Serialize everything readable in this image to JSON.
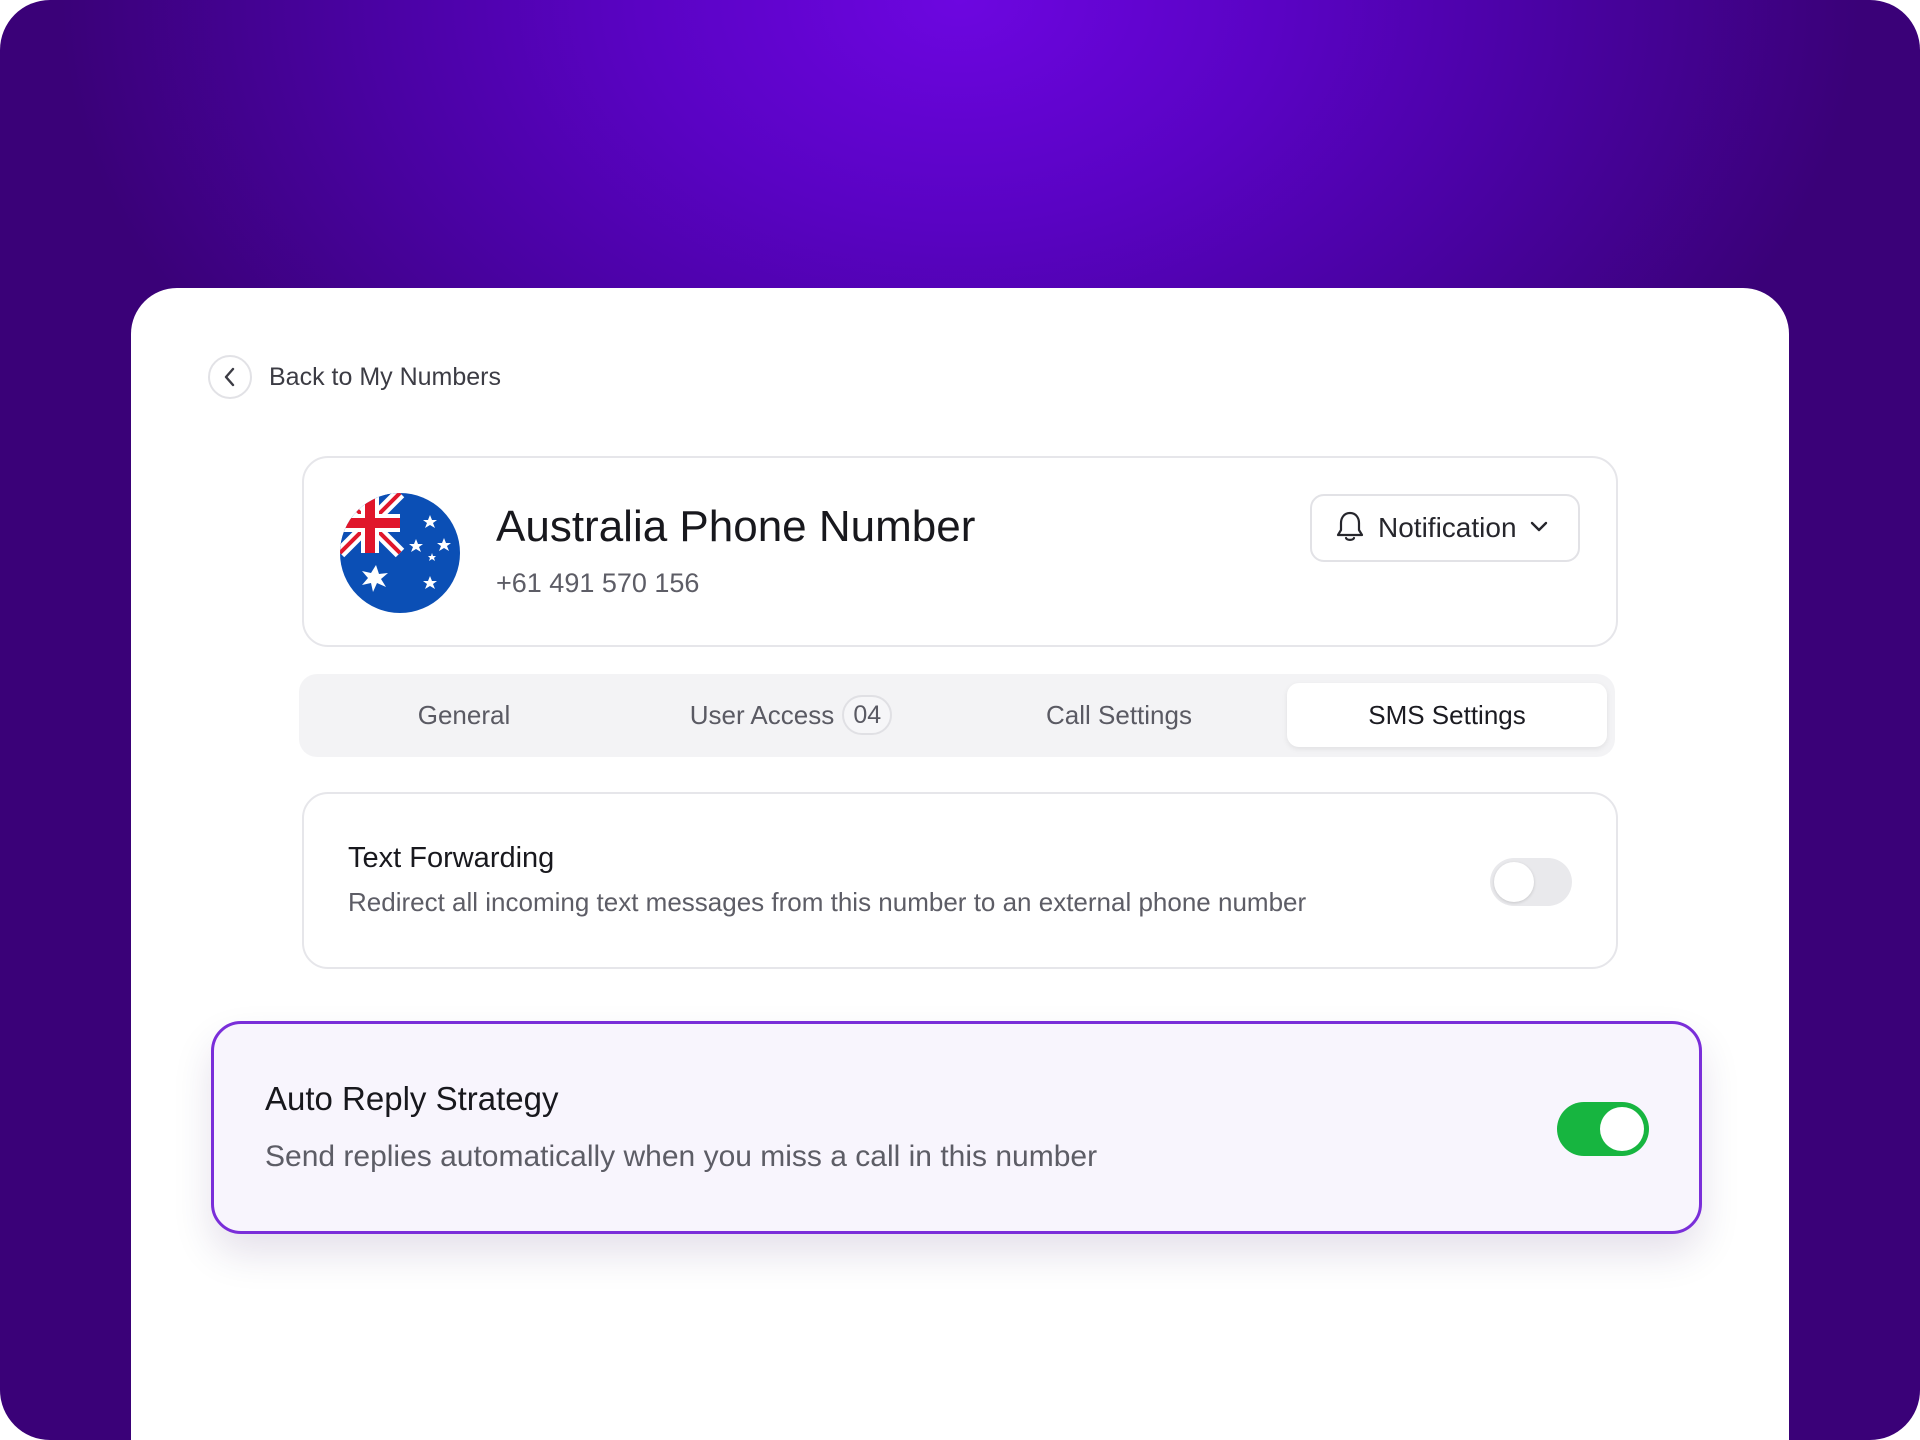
{
  "back": {
    "label": "Back to My Numbers",
    "icon": "chevron-left-icon"
  },
  "header": {
    "title": "Australia Phone Number",
    "phone": "+61 491 570 156",
    "flag_icon": "australia-flag-icon",
    "notification": {
      "label": "Notification",
      "icon": "bell-icon",
      "chevron": "chevron-down-icon"
    }
  },
  "tabs": [
    {
      "label": "General",
      "active": false
    },
    {
      "label": "User Access",
      "badge": "04",
      "active": false
    },
    {
      "label": "Call Settings",
      "active": false
    },
    {
      "label": "SMS Settings",
      "active": true
    }
  ],
  "settings": {
    "text_forwarding": {
      "title": "Text Forwarding",
      "description": "Redirect all incoming text messages from this number to an external phone number",
      "enabled": false
    },
    "auto_reply": {
      "title": "Auto Reply Strategy",
      "description": "Send replies automatically when you miss a call in this number",
      "enabled": true
    }
  },
  "colors": {
    "background_purple": "#5a03c4",
    "highlight_border": "#7a2ed9",
    "toggle_on": "#17b540",
    "toggle_off": "#e9e9ec"
  }
}
